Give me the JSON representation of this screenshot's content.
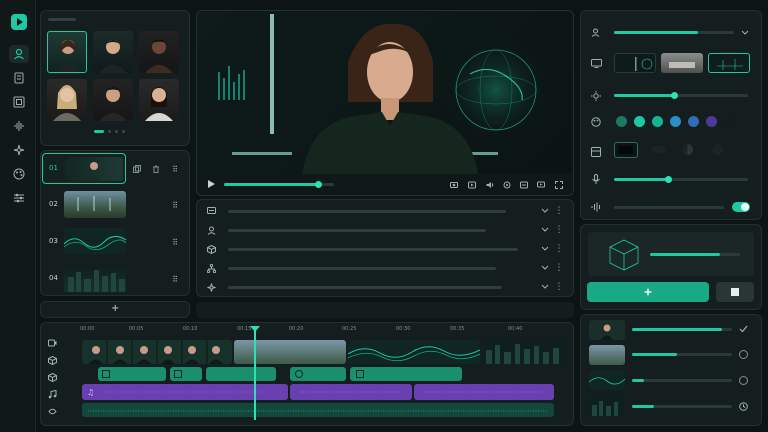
{
  "app": {
    "brand_color": "#1ec9a3",
    "logo_icon": "play-logo-icon"
  },
  "sidebar": {
    "icons": [
      "user-icon",
      "document-icon",
      "grid-icon",
      "audio-wave-icon",
      "sparkle-icon",
      "palette-icon",
      "sliders-icon"
    ]
  },
  "avatars": {
    "selected_index": 0,
    "pager_pages": 4,
    "pager_active": 0
  },
  "scenes": {
    "items": [
      {
        "number": "01",
        "selected": true
      },
      {
        "number": "02",
        "selected": false
      },
      {
        "number": "03",
        "selected": false
      },
      {
        "number": "04",
        "selected": false
      }
    ],
    "add_label": "+"
  },
  "player": {
    "progress": 0.85
  },
  "timeline": {
    "ticks": [
      "00:00",
      "00:05",
      "00:10",
      "00:15",
      "00:20",
      "00:25",
      "00:30",
      "00:35",
      "00:40"
    ],
    "playhead_time": "00:15"
  },
  "properties": {
    "voice_level": 0.7,
    "brightness": 0.45,
    "mic_level": 0.4,
    "swatch_colors": [
      "#1a7a63",
      "#1ec9a3",
      "#17b58f",
      "#2a8fc6",
      "#2f6db5",
      "#4a3a9a",
      "#141c1c"
    ],
    "toggle_on": true
  },
  "layers": {
    "progress": [
      0.9,
      0.45,
      0.12,
      0.22
    ]
  },
  "generate_panel": {
    "progress": 0.78
  }
}
